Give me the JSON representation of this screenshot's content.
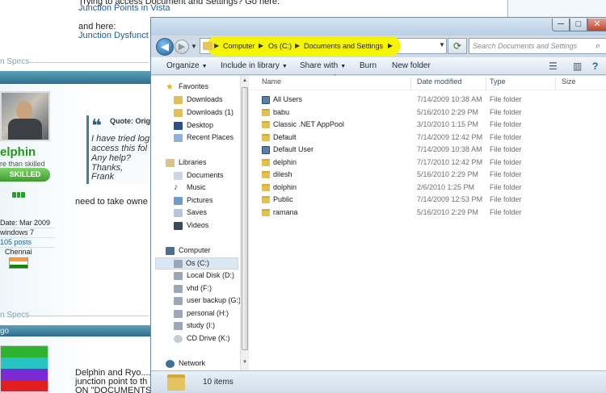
{
  "forum": {
    "top_line_1": "Trying to access Document and Settings? Go here:",
    "link_1": "Junction Points in Vista",
    "and_here": "and here:",
    "link_2": "Junction Dysfunct",
    "specs_1": "n Specs",
    "username": "elphin",
    "user_title": "re than skilled",
    "skill_badge": "SKILLED",
    "join_date": "Date: Mar 2009",
    "os": "windows 7",
    "posts": "105 posts",
    "location": "Chennai",
    "quote_header": "Quote: Origi",
    "quote_lines": [
      "I have tried log",
      "access this fol",
      "Any help?",
      "Thanks,",
      "Frank"
    ],
    "reply_text": "need to take owne",
    "specs_2": "n Specs",
    "section_label": "go",
    "post2_lines": [
      "Delphin and Ryo....",
      "junction point to th",
      "ON \"DOCUMENTS A"
    ],
    "colors": {
      "band": "#2c6f8d",
      "username": "#1f9a17",
      "link": "#1a5fa8"
    }
  },
  "window": {
    "buttons": {
      "minimize": "─",
      "maximize": "□",
      "close": "✕"
    },
    "nav_buttons": {
      "back": "◀",
      "forward": "▶",
      "history": "▼"
    },
    "address": {
      "breadcrumbs": [
        "Computer",
        "Os (C:)",
        "Documents and Settings"
      ],
      "separator": "▶",
      "dropdown": "▼",
      "highlight_color": "#f5f500"
    },
    "refresh_icon": "⟳",
    "search": {
      "placeholder": "Search Documents and Settings",
      "icon": "search-icon"
    },
    "toolbar": {
      "organize": "Organize",
      "include": "Include in library",
      "share": "Share with",
      "burn": "Burn",
      "new_folder": "New folder",
      "dropdown_arrow": "▼"
    },
    "nav": {
      "favorites_header": "Favorites",
      "favorites": [
        "Downloads",
        "Downloads (1)",
        "Desktop",
        "Recent Places"
      ],
      "libraries_header": "Libraries",
      "libraries": [
        "Documents",
        "Music",
        "Pictures",
        "Saves",
        "Videos"
      ],
      "computer_header": "Computer",
      "drives": [
        "Os (C:)",
        "Local Disk (D:)",
        "vhd (F:)",
        "user backup (G:)",
        "personal (H:)",
        "study (I:)",
        "CD Drive (K:)"
      ],
      "network_header": "Network",
      "selected": "Os (C:)"
    },
    "columns": {
      "name": "Name",
      "date": "Date modified",
      "type": "Type",
      "size": "Size"
    },
    "files": [
      {
        "name": "All Users",
        "date": "7/14/2009 10:38 AM",
        "type": "File folder",
        "icon": "shortcut-folder-icon"
      },
      {
        "name": "babu",
        "date": "5/16/2010 2:29 PM",
        "type": "File folder",
        "icon": "folder-icon"
      },
      {
        "name": "Classic .NET AppPool",
        "date": "3/10/2010 1:15 PM",
        "type": "File folder",
        "icon": "folder-icon"
      },
      {
        "name": "Default",
        "date": "7/14/2009 12:42 PM",
        "type": "File folder",
        "icon": "folder-icon"
      },
      {
        "name": "Default User",
        "date": "7/14/2009 10:38 AM",
        "type": "File folder",
        "icon": "shortcut-folder-icon"
      },
      {
        "name": "delphin",
        "date": "7/17/2010 12:42 PM",
        "type": "File folder",
        "icon": "folder-icon"
      },
      {
        "name": "dilesh",
        "date": "5/16/2010 2:29 PM",
        "type": "File folder",
        "icon": "folder-icon"
      },
      {
        "name": "dolphin",
        "date": "2/6/2010 1:25 PM",
        "type": "File folder",
        "icon": "folder-icon"
      },
      {
        "name": "Public",
        "date": "7/14/2009 12:53 PM",
        "type": "File folder",
        "icon": "folder-icon"
      },
      {
        "name": "ramana",
        "date": "5/16/2010 2:29 PM",
        "type": "File folder",
        "icon": "folder-icon"
      }
    ],
    "status": "10 items"
  }
}
